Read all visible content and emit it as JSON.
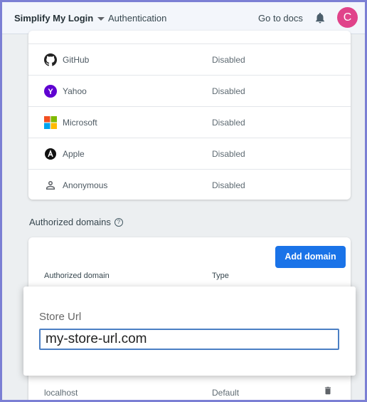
{
  "topbar": {
    "project_name": "Simplify My Login",
    "section": "Authentication",
    "docs_link": "Go to docs",
    "avatar_letter": "C"
  },
  "providers": [
    {
      "name": "GitHub",
      "status": "Disabled",
      "icon": "github-icon"
    },
    {
      "name": "Yahoo",
      "status": "Disabled",
      "icon": "yahoo-icon"
    },
    {
      "name": "Microsoft",
      "status": "Disabled",
      "icon": "microsoft-icon"
    },
    {
      "name": "Apple",
      "status": "Disabled",
      "icon": "apple-icon"
    },
    {
      "name": "Anonymous",
      "status": "Disabled",
      "icon": "person-icon"
    }
  ],
  "authorized_domains": {
    "title": "Authorized domains",
    "add_button": "Add domain",
    "columns": [
      "Authorized domain",
      "Type"
    ],
    "rows": [
      {
        "domain": "localhost",
        "type": "Default"
      }
    ]
  },
  "dialog": {
    "label": "Store Url",
    "value": "my-store-url.com"
  },
  "colors": {
    "accent": "#1a73e8",
    "avatar": "#e0438a",
    "frame": "#7b7fd4"
  }
}
